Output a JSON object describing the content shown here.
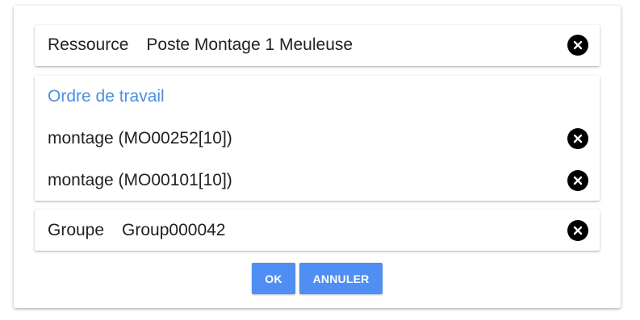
{
  "ressource": {
    "label": "Ressource",
    "value": "Poste Montage 1 Meuleuse"
  },
  "ordre": {
    "title": "Ordre de travail",
    "items": [
      {
        "text": "montage (MO00252[10])"
      },
      {
        "text": "montage (MO00101[10])"
      }
    ]
  },
  "groupe": {
    "label": "Groupe",
    "value": "Group000042"
  },
  "actions": {
    "ok_label": "OK",
    "cancel_label": "ANNULER"
  },
  "colors": {
    "accent": "#4f8ff3",
    "section_title": "#4a90e2",
    "clear_icon_bg": "#000000"
  },
  "icons": {
    "clear": "close-circle-icon"
  }
}
